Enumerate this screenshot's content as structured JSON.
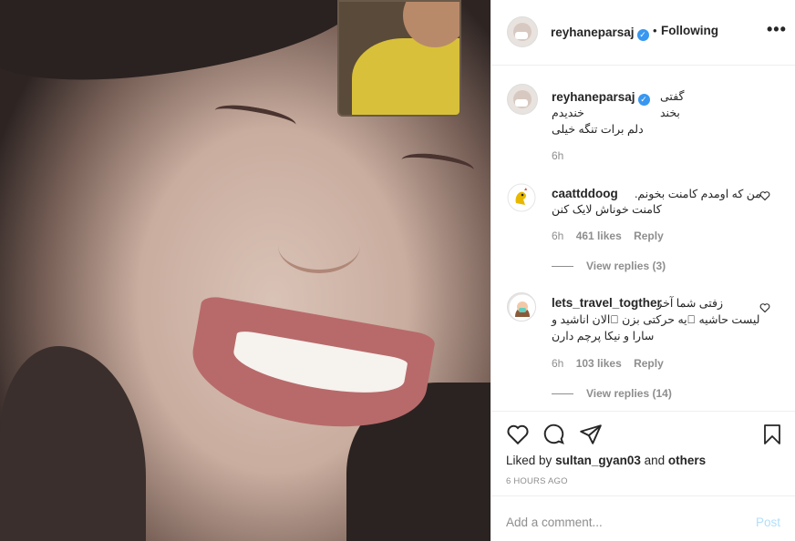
{
  "header": {
    "username": "reyhaneparsaj",
    "separator": "•",
    "follow_status": "Following",
    "more": "•••"
  },
  "caption": {
    "username": "reyhaneparsaj",
    "line1": "گفتی بخند",
    "line2": "خندیدم",
    "line3": "دلم برات تنگه خیلی",
    "age": "6h"
  },
  "comments": [
    {
      "username": "caattddoog",
      "line1": "من که اومدم کامنت بخونم.",
      "line2": "کامنت خوناش لایک کنن",
      "age": "6h",
      "likes": "461 likes",
      "reply": "Reply",
      "view_replies": "View replies (3)"
    },
    {
      "username": "lets_travel_togther",
      "line1": "زفتی شما آخر",
      "line2": "لیست حاشیه \u0000یه حرکتی بزن \u0000الان اناشید و",
      "line3": "سارا و نیکا پرچم دارن",
      "age": "6h",
      "likes": "103 likes",
      "reply": "Reply",
      "view_replies": "View replies (14)"
    }
  ],
  "actions": {
    "liked_prefix": "Liked by",
    "liked_user": "sultan_gyan03",
    "liked_and": "and",
    "liked_others": "others",
    "timestamp": "6 HOURS AGO"
  },
  "comment_box": {
    "placeholder": "Add a comment...",
    "post_label": "Post"
  },
  "icons": [
    "heart-icon",
    "comment-icon",
    "share-icon",
    "save-icon",
    "verified-icon",
    "more-icon"
  ],
  "colors": {
    "verified": "#3897f0",
    "post_disabled": "#b2dffc",
    "muted": "#8e8e8e"
  }
}
